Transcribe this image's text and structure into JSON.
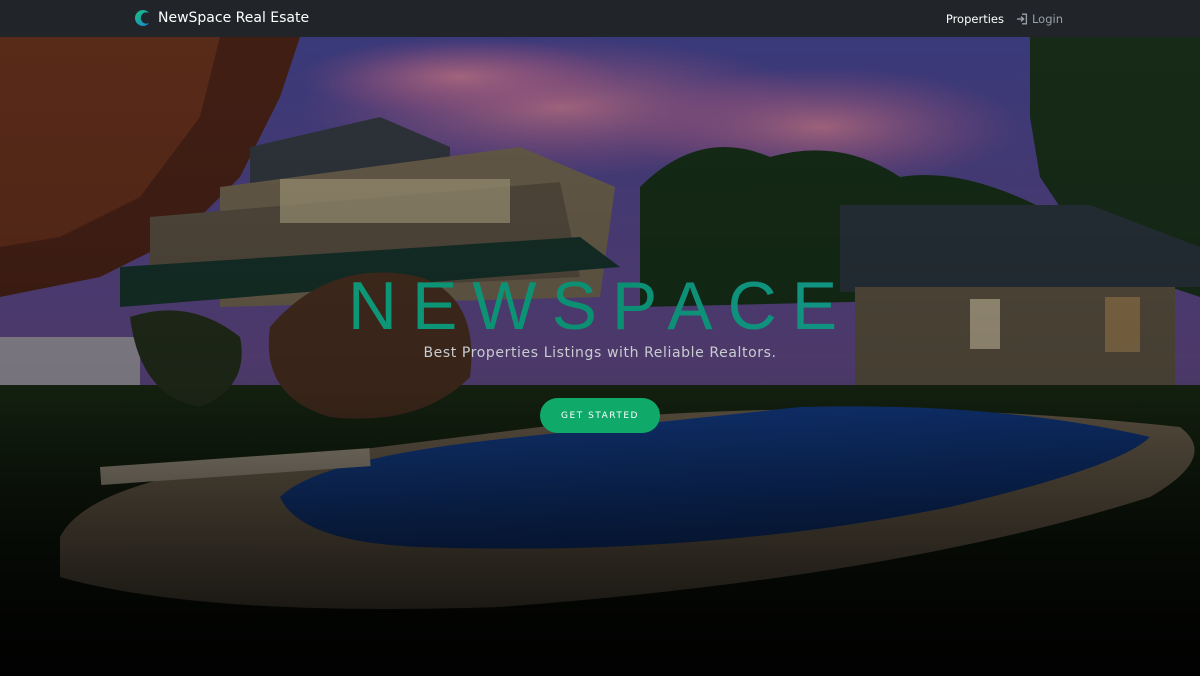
{
  "navbar": {
    "brand_name": "NewSpace Real Esate",
    "logo_icon": "crescent-logo-icon",
    "links": [
      {
        "label": "Properties"
      },
      {
        "label": "Login",
        "icon": "login-icon"
      }
    ]
  },
  "hero": {
    "title": "NEWSPACE",
    "subtitle": "Best Properties Listings with Reliable Realtors.",
    "cta_label": "GET STARTED",
    "background": "house-with-pool-at-dusk"
  },
  "colors": {
    "navbar_bg": "#212529",
    "accent_green": "#0fa96a",
    "title_gradient_start": "#10a37f",
    "title_gradient_end": "#1a9a9a",
    "subtitle_text": "#c9ccd1",
    "nav_muted": "#9aa0a6"
  }
}
